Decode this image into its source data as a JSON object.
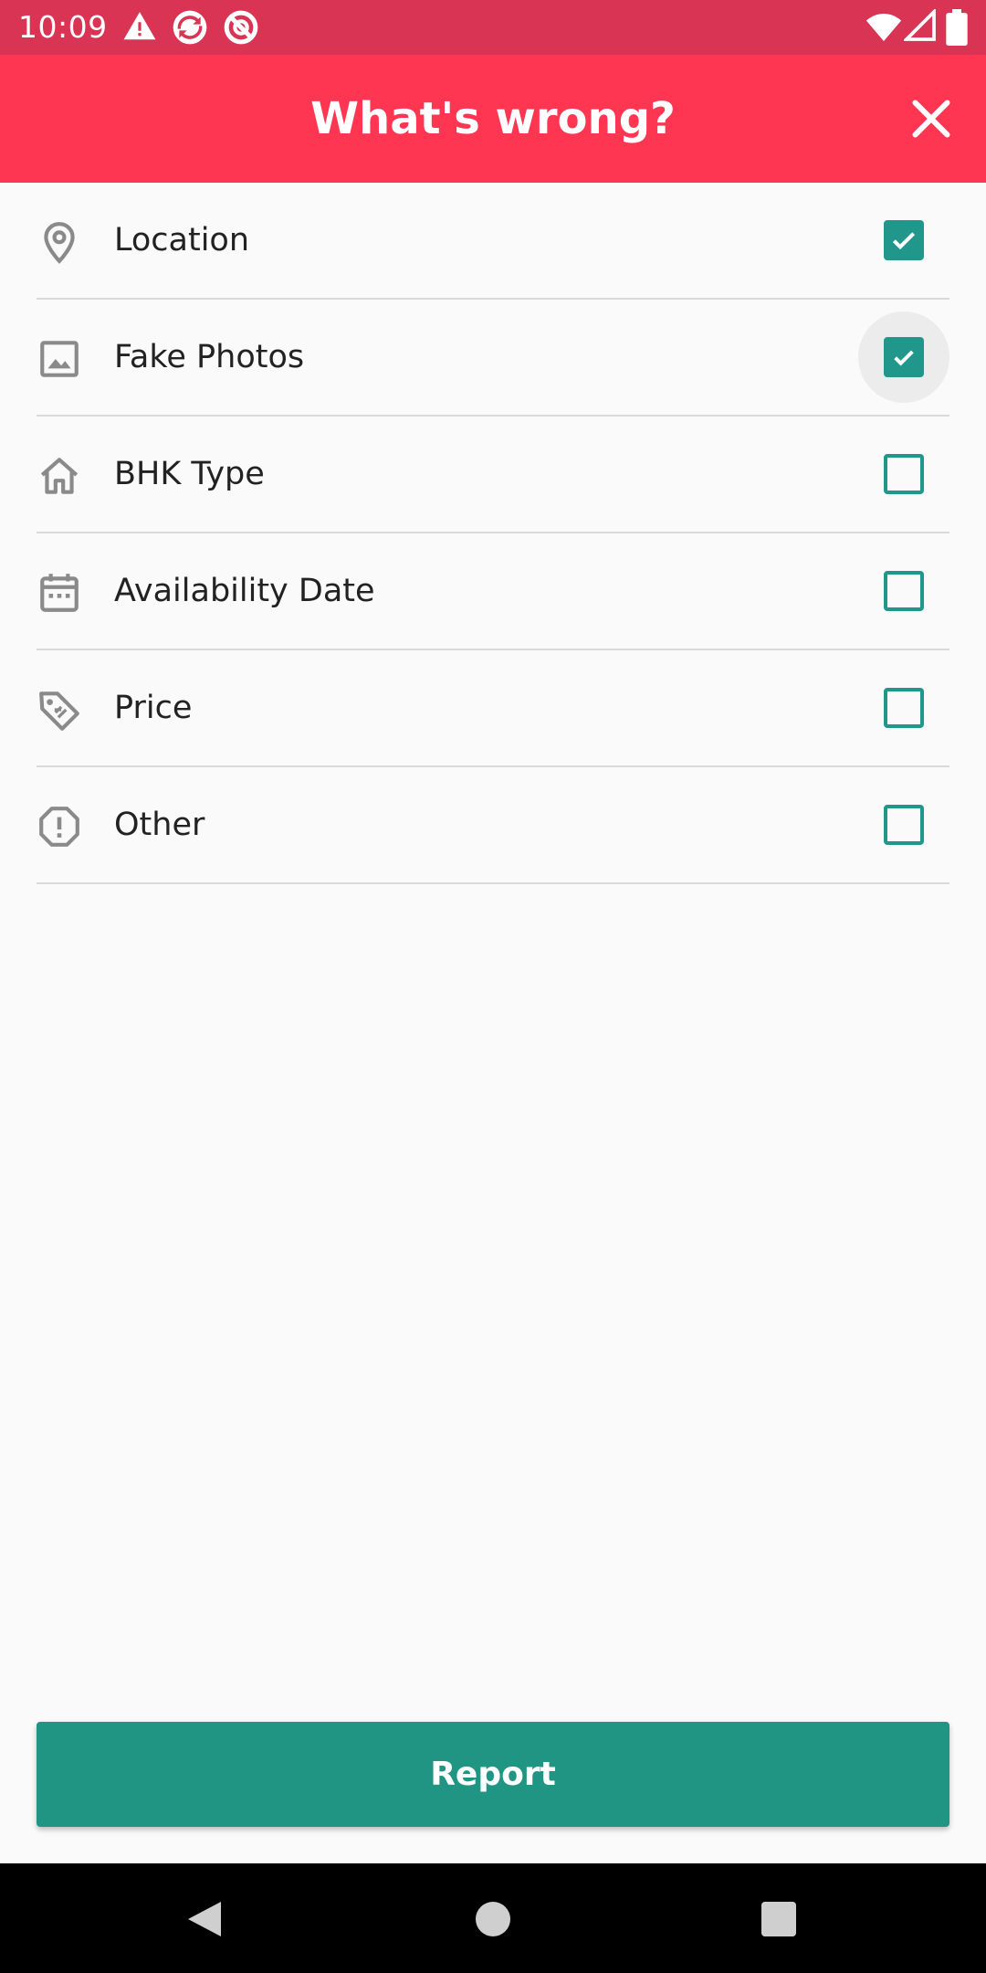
{
  "status_bar": {
    "time": "10:09",
    "left_icons": [
      "warning-icon",
      "sync-app-icon",
      "blocked-app-icon"
    ],
    "right_icons": [
      "wifi-icon",
      "cellular-signal-icon",
      "battery-icon"
    ]
  },
  "app_bar": {
    "title": "What's wrong?",
    "close_icon": "close-icon"
  },
  "options": [
    {
      "label": "Location",
      "icon": "location-pin-icon",
      "checked": true
    },
    {
      "label": "Fake Photos",
      "icon": "image-icon",
      "checked": true
    },
    {
      "label": "BHK Type",
      "icon": "home-icon",
      "checked": false
    },
    {
      "label": "Availability Date",
      "icon": "calendar-icon",
      "checked": false
    },
    {
      "label": "Price",
      "icon": "price-tag-icon",
      "checked": false
    },
    {
      "label": "Other",
      "icon": "alert-octagon-icon",
      "checked": false
    }
  ],
  "report_button": {
    "label": "Report"
  },
  "colors": {
    "status_bar": "#d93453",
    "app_bar": "#ff3651",
    "accent": "#21968a",
    "background": "#fafafa"
  },
  "nav_bar": {
    "icons": [
      "back-icon",
      "home-circle-icon",
      "recents-icon"
    ]
  }
}
